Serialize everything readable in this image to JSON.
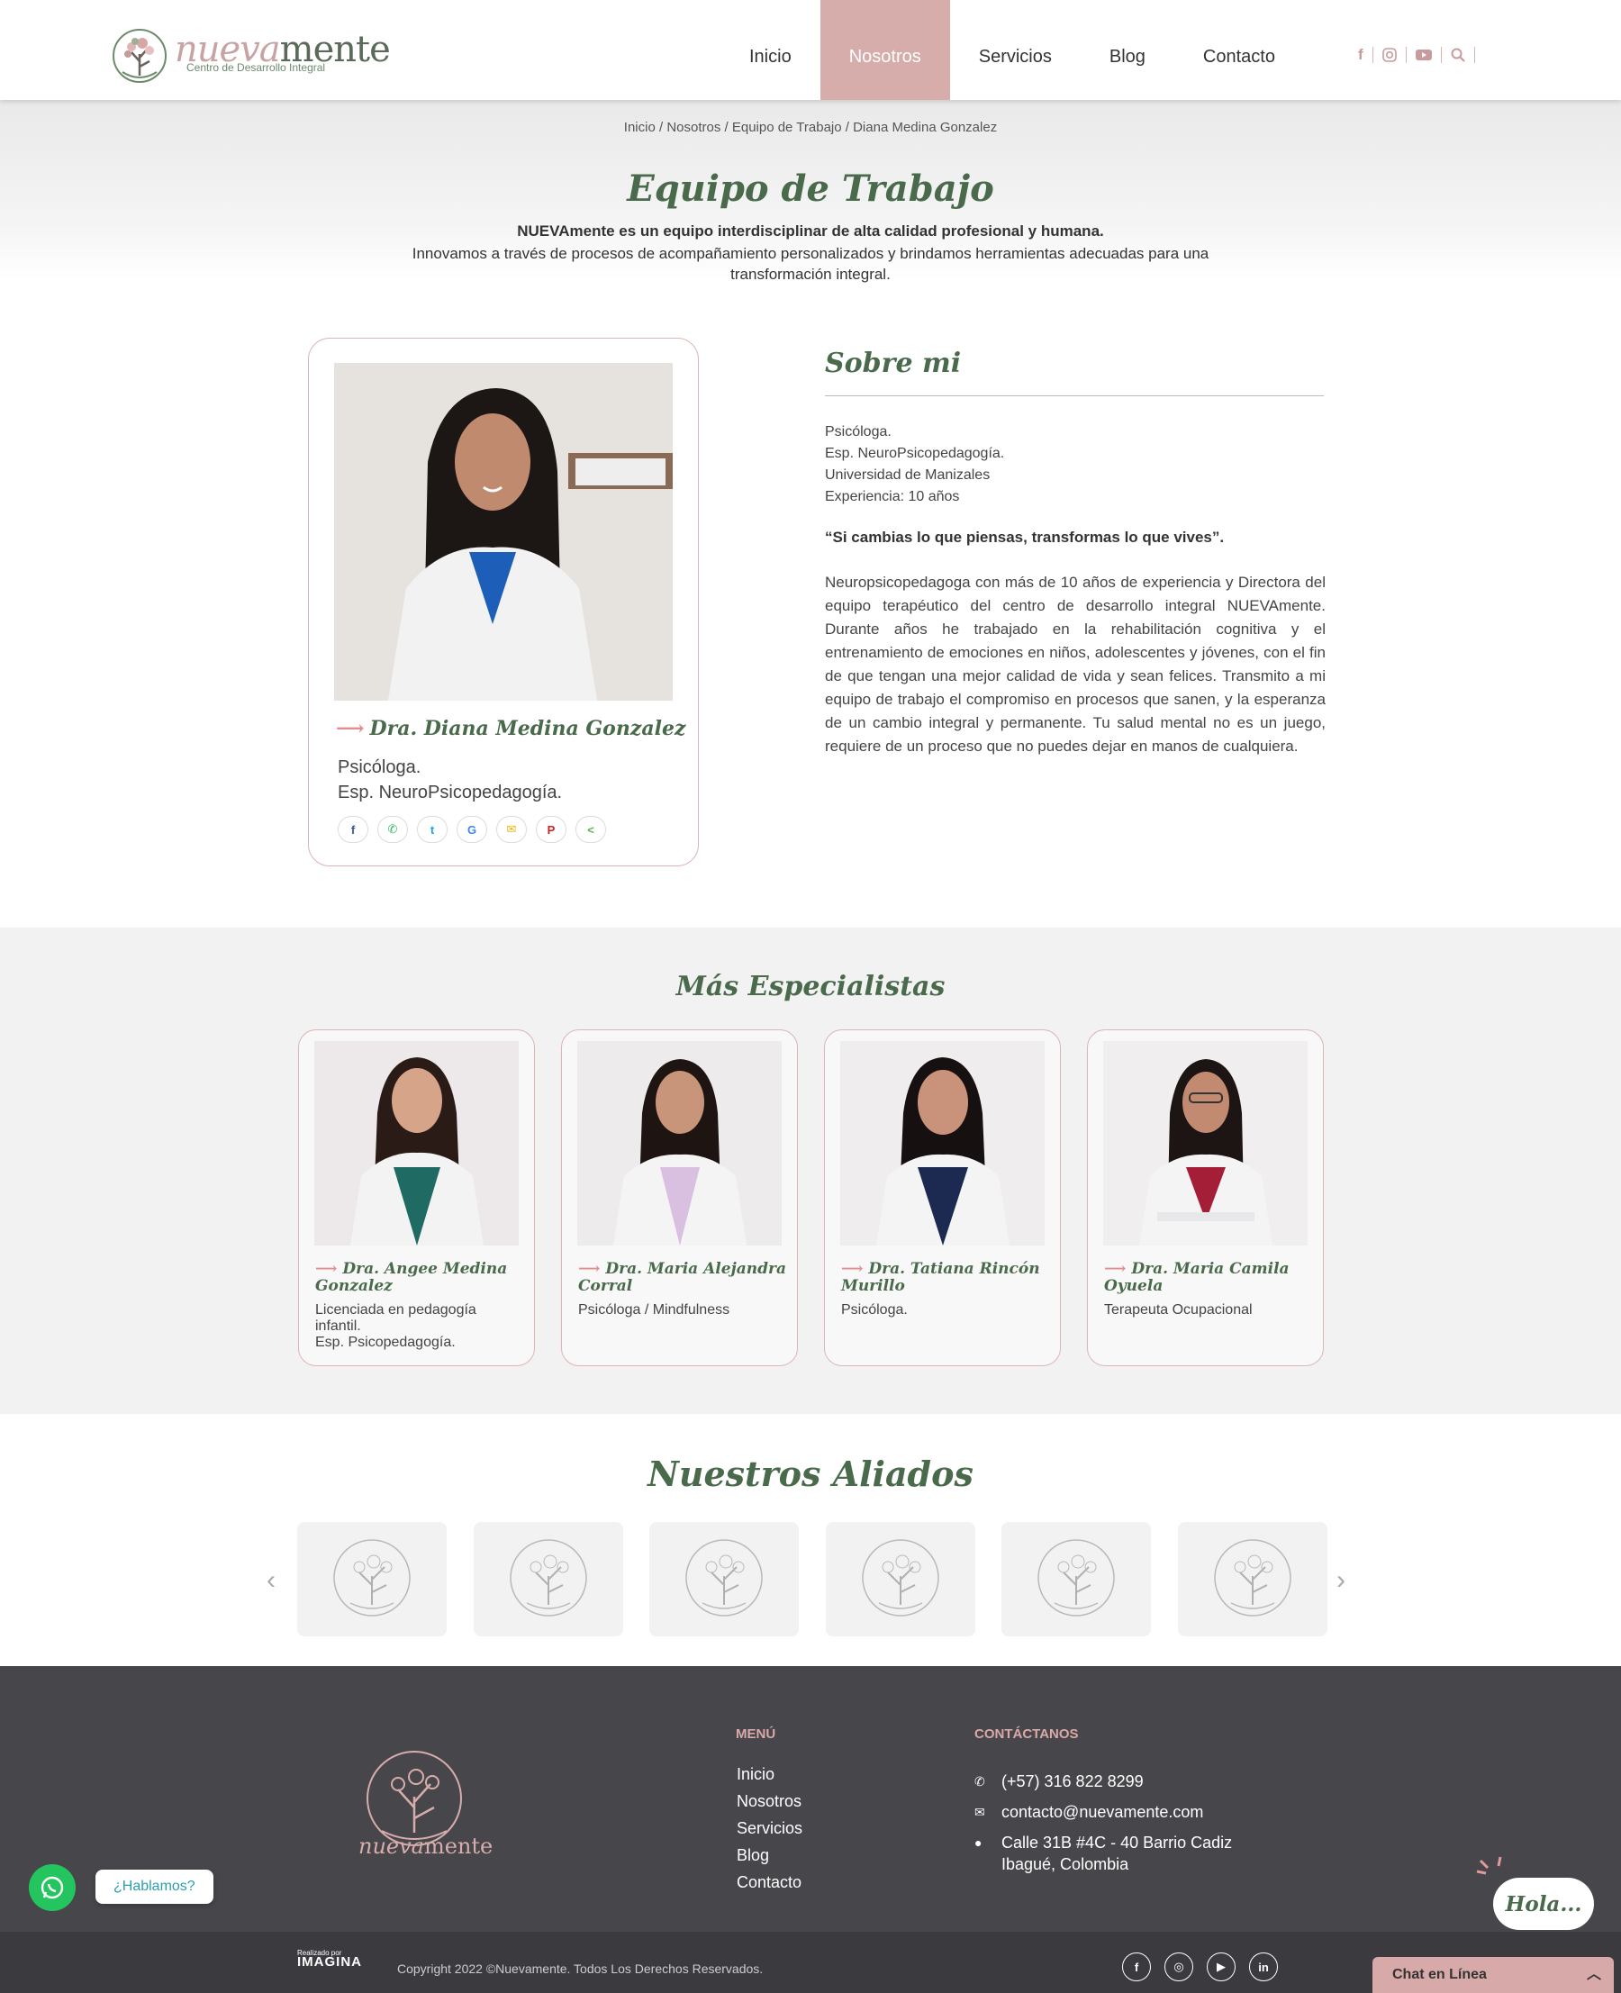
{
  "header": {
    "logo_word_1": "nueva",
    "logo_word_2": "mente",
    "logo_tagline": "Centro de Desarrollo Integral",
    "nav": [
      "Inicio",
      "Nosotros",
      "Servicios",
      "Blog",
      "Contacto"
    ],
    "active_nav": "Nosotros",
    "icons": [
      "facebook-icon",
      "instagram-icon",
      "youtube-icon",
      "search-icon"
    ]
  },
  "banner": {
    "breadcrumb": "Inicio / Nosotros / Equipo de Trabajo / Diana Medina Gonzalez",
    "title": "Equipo de Trabajo",
    "intro_bold": "NUEVAmente es un equipo interdisciplinar de alta calidad profesional y humana.",
    "intro": "Innovamos a través de procesos de acompañamiento personalizados y brindamos herramientas adecuadas para una transformación integral."
  },
  "profile": {
    "name": "Dra. Diana Medina Gonzalez",
    "role_line_1": "Psicóloga.",
    "role_line_2": "Esp. NeuroPsicopedagogía.",
    "share_icons": [
      "facebook-icon",
      "whatsapp-icon",
      "twitter-icon",
      "google-icon",
      "email-icon",
      "pinterest-icon",
      "share-icon"
    ]
  },
  "about": {
    "title": "Sobre mi",
    "creds": [
      "Psicóloga.",
      "Esp. NeuroPsicopedagogía.",
      "Universidad de Manizales",
      "Experiencia: 10 años"
    ],
    "quote": "“Si cambias lo que piensas, transformas lo que vives”.",
    "text": "Neuropsicopedagoga con más de 10 años de experiencia y Directora del equipo terapéutico del centro de desarrollo integral NUEVAmente. Durante años he trabajado en la rehabilitación cognitiva y el entrenamiento de emociones en niños, adolescentes y jóvenes, con el fin de que tengan una mejor calidad de vida y sean felices. Transmito a mi equipo de trabajo el compromiso en procesos que sanen, y la esperanza de un cambio integral y permanente. Tu salud mental no es un juego, requiere de un proceso que no puedes dejar en manos de cualquiera."
  },
  "specialists": {
    "title": "Más Especialistas",
    "items": [
      {
        "name": "Dra. Angee Medina Gonzalez",
        "role": "Licenciada en pedagogía infantil.",
        "role_2": "Esp. Psicopedagogía.",
        "shirt": "#1f6b64"
      },
      {
        "name": "Dra. Maria Alejandra Corral",
        "role": "Psicóloga / Mindfulness",
        "role_2": "",
        "shirt": "#d9bfe0"
      },
      {
        "name": "Dra. Tatiana Rincón Murillo",
        "role": "Psicóloga.",
        "role_2": "",
        "shirt": "#1c2a52"
      },
      {
        "name": "Dra. Maria Camila Oyuela",
        "role": "Terapeuta Ocupacional",
        "role_2": "",
        "shirt": "#a51e37"
      }
    ]
  },
  "allies": {
    "title": "Nuestros Aliados",
    "count_visible": 6
  },
  "footer": {
    "logo_word_1": "nueva",
    "logo_word_2": "mente",
    "menu_heading": "MENÚ",
    "menu": [
      "Inicio",
      "Nosotros",
      "Servicios",
      "Blog",
      "Contacto"
    ],
    "contact_heading": "CONTÁCTANOS",
    "phone": "(+57) 316 822 8299",
    "email": "contacto@nuevamente.com",
    "address_1": "Calle 31B #4C - 40 Barrio Cadiz",
    "address_2": "Ibagué, Colombia",
    "made_by_label": "Realizado por",
    "made_by_brand": "IMAGINA",
    "copyright": "Copyright 2022 ©Nuevamente. Todos Los Derechos Reservados.",
    "social": [
      "facebook-icon",
      "instagram-icon",
      "youtube-icon",
      "linkedin-icon"
    ]
  },
  "widgets": {
    "whatsapp_bubble": "¿Hablamos?",
    "hola": "Hola...",
    "chat_label": "Chat en Línea"
  },
  "colors": {
    "accent_pink": "#d6adab",
    "title_green": "#4a6a4c",
    "footer_bg": "#47464b",
    "whatsapp_green": "#24c55e"
  }
}
